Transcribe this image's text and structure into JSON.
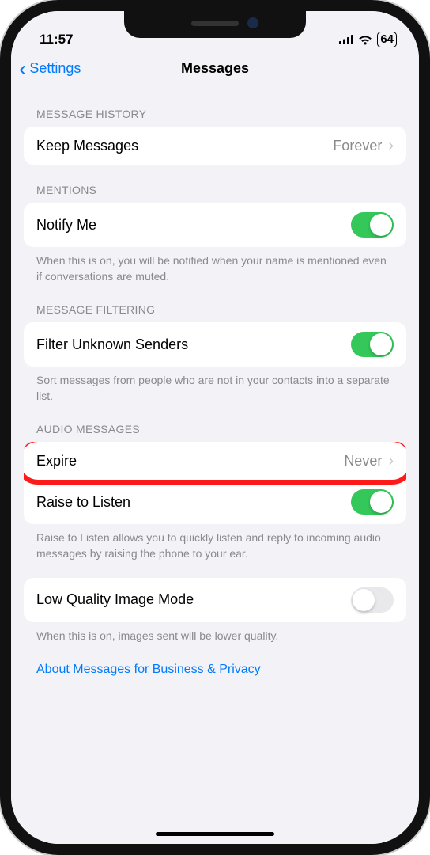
{
  "statusBar": {
    "time": "11:57",
    "batteryPct": "64"
  },
  "nav": {
    "back": "Settings",
    "title": "Messages"
  },
  "sections": {
    "messageHistory": {
      "header": "MESSAGE HISTORY",
      "keepMessages": {
        "label": "Keep Messages",
        "value": "Forever"
      }
    },
    "mentions": {
      "header": "MENTIONS",
      "notifyMe": {
        "label": "Notify Me",
        "on": true
      },
      "footer": "When this is on, you will be notified when your name is mentioned even if conversations are muted."
    },
    "messageFiltering": {
      "header": "MESSAGE FILTERING",
      "filterUnknown": {
        "label": "Filter Unknown Senders",
        "on": true
      },
      "footer": "Sort messages from people who are not in your contacts into a separate list."
    },
    "audioMessages": {
      "header": "AUDIO MESSAGES",
      "expire": {
        "label": "Expire",
        "value": "Never"
      },
      "raiseToListen": {
        "label": "Raise to Listen",
        "on": true
      },
      "footer": "Raise to Listen allows you to quickly listen and reply to incoming audio messages by raising the phone to your ear."
    },
    "lowQuality": {
      "label": "Low Quality Image Mode",
      "on": false,
      "footer": "When this is on, images sent will be lower quality."
    }
  },
  "link": "About Messages for Business & Privacy"
}
